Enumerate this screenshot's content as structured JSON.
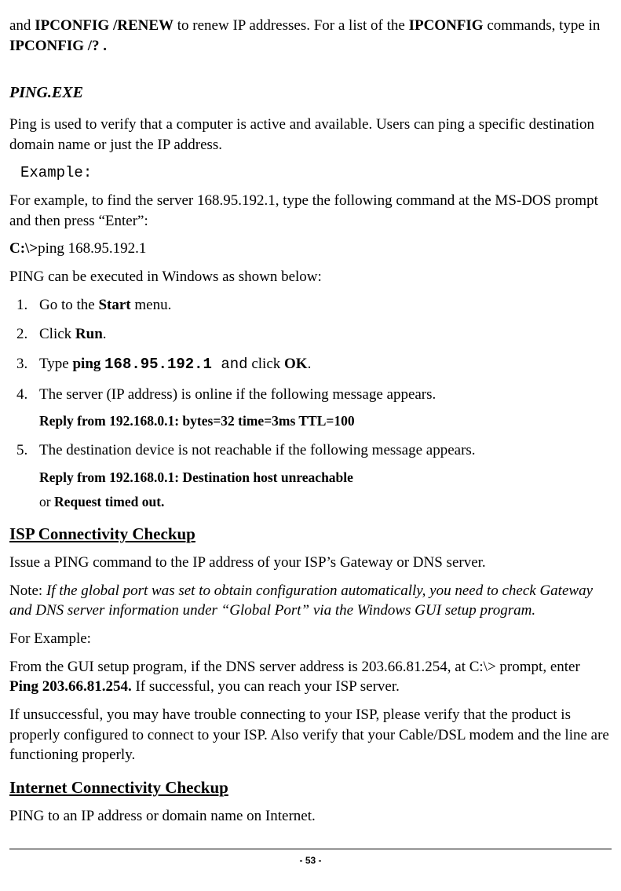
{
  "intro": {
    "part1": "and ",
    "cmd1": "IPCONFIG /RENEW",
    "part2": " to renew IP addresses. For a list of the ",
    "cmd2": "IPCONFIG",
    "part3": " commands, type in ",
    "cmd3": "IPCONFIG /? .",
    "part4": ""
  },
  "ping": {
    "heading": "PING.EXE",
    "desc": "Ping is used to verify that a computer is active and available. Users can ping a specific destination domain name or just the IP address.",
    "example_label": "Example:",
    "example_desc": "For example, to find the server 168.95.192.1, type the following command at the MS-DOS prompt and then press “Enter”:",
    "prompt_bold": "C:\\>",
    "prompt_rest": "ping 168.95.192.1",
    "win_intro": "PING can be executed in Windows as shown below:",
    "steps": {
      "s1a": "Go to the ",
      "s1b": "Start",
      "s1c": " menu.",
      "s2a": "Click ",
      "s2b": "Run",
      "s2c": ".",
      "s3a": "Type ",
      "s3b": "ping ",
      "s3c": "168.95.192.1 ",
      "s3d": "and",
      "s3e": " click ",
      "s3f": "OK",
      "s3g": ".",
      "s4": "The server (IP address) is online if the following message appears.",
      "s4sub": "Reply from 192.168.0.1: bytes=32 time=3ms TTL=100",
      "s5": "The destination device is not reachable if the following message appears.",
      "s5sub1": "Reply from 192.168.0.1: Destination host unreachable",
      "s5sub2a": "or ",
      "s5sub2b": "Request timed out."
    }
  },
  "isp": {
    "heading": "ISP Connectivity Checkup",
    "p1": "Issue a PING command to the IP address of your ISP’s Gateway or DNS server.",
    "note_label": "Note: ",
    "note_body": "If the global port was set to obtain configuration automatically, you need to check Gateway and DNS server information under “Global Port” via the Windows GUI setup program.",
    "for_example": "For Example:",
    "p2a": "From the GUI setup program, if the DNS server address is 203.66.81.254, at C:\\> prompt, enter ",
    "p2b": "Ping 203.66.81.254.",
    "p2c": " If successful, you can reach your ISP server.",
    "p3": "If unsuccessful, you may have trouble connecting to your ISP, please verify that the product is properly configured to connect to your ISP.  Also verify that your Cable/DSL modem and the line are functioning properly."
  },
  "internet": {
    "heading": "Internet Connectivity Checkup",
    "p1": "PING to an IP address or domain name on Internet."
  },
  "page_number": "- 53 -"
}
